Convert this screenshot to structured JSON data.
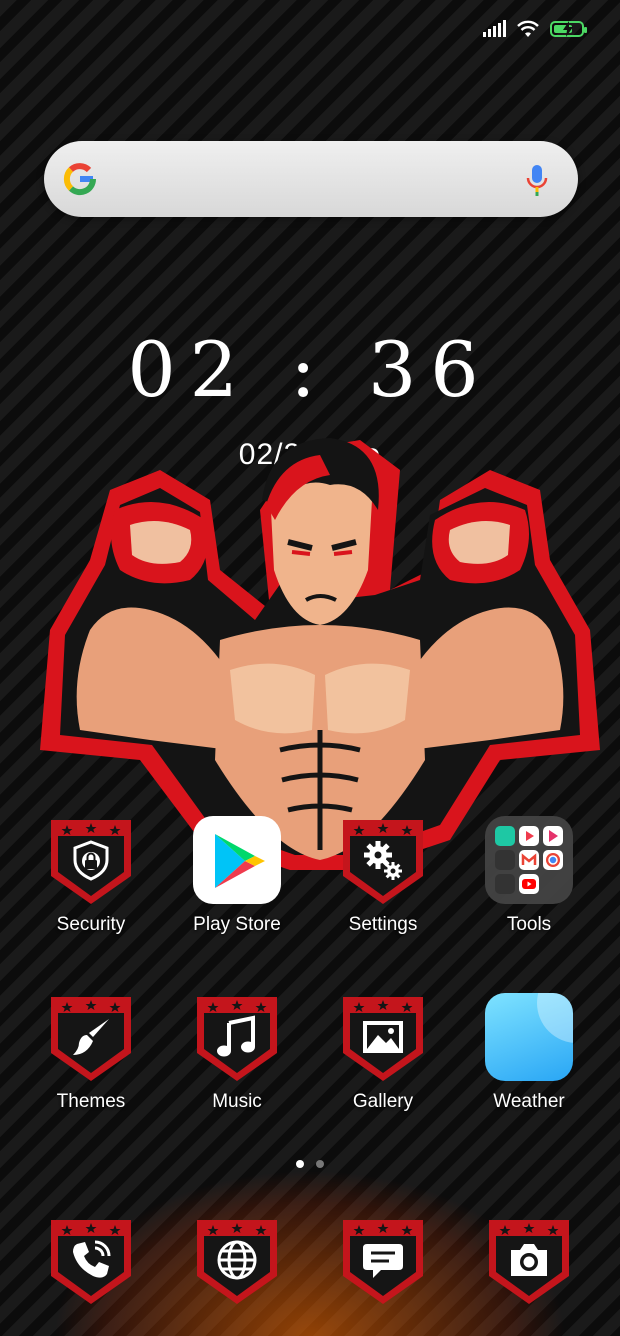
{
  "status_bar": {
    "signal": "signal-icon",
    "wifi": "wifi-icon",
    "battery": "battery-charging-icon",
    "battery_level": 0.7
  },
  "search": {
    "logo": "google-g-icon",
    "voice": "microphone-icon"
  },
  "clock": {
    "time": "02 : 36",
    "date": "02/25 Tue"
  },
  "apps": [
    {
      "label": "Security",
      "icon": "shield-lock-icon"
    },
    {
      "label": "Play Store",
      "icon": "play-store-icon"
    },
    {
      "label": "Settings",
      "icon": "gear-icon"
    },
    {
      "label": "Tools",
      "icon": "folder-icon"
    },
    {
      "label": "Themes",
      "icon": "paintbrush-icon"
    },
    {
      "label": "Music",
      "icon": "music-note-icon"
    },
    {
      "label": "Gallery",
      "icon": "image-icon"
    },
    {
      "label": "Weather",
      "icon": "weather-icon"
    }
  ],
  "pager": {
    "pages": 2,
    "current": 1
  },
  "dock": [
    {
      "icon": "phone-icon"
    },
    {
      "icon": "globe-icon"
    },
    {
      "icon": "message-icon"
    },
    {
      "icon": "camera-icon"
    }
  ],
  "colors": {
    "badge_red": "#c4151c",
    "badge_dark": "#151515",
    "accent_green": "#4cd964"
  }
}
